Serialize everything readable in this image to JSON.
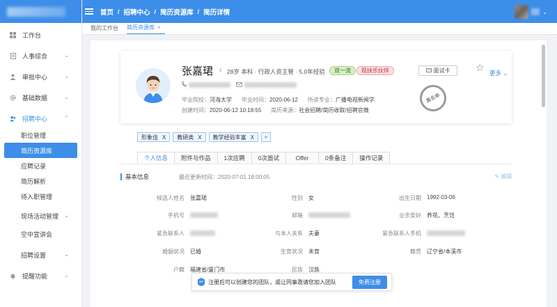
{
  "topbar": {
    "breadcrumbs": [
      "首页",
      "招聘中心",
      "简历资源库",
      "简历详情"
    ],
    "separator": "/"
  },
  "sidebar": {
    "items": [
      {
        "label": "工作台",
        "icon": "grid-icon",
        "has_children": false
      },
      {
        "label": "人事综合",
        "icon": "document-icon",
        "has_children": true
      },
      {
        "label": "审批中心",
        "icon": "person-icon",
        "has_children": true
      },
      {
        "label": "基础数据",
        "icon": "gear-icon",
        "has_children": true
      },
      {
        "label": "招聘中心",
        "icon": "people-icon",
        "has_children": true,
        "expanded": true,
        "children": [
          "职位管理",
          "简历资源库",
          "应聘记录",
          "简历解析",
          "待入职管理"
        ]
      },
      {
        "label": "现场活动管理",
        "icon": "",
        "has_children": true
      },
      {
        "label": "空中宣讲会",
        "icon": "",
        "has_children": false
      },
      {
        "label": "招聘设置",
        "icon": "",
        "has_children": true
      },
      {
        "label": "提醒功能",
        "icon": "bell-icon",
        "has_children": true
      }
    ],
    "active_child": "简历资源库"
  },
  "tabs": {
    "items": [
      "我的工作台",
      "简历资源库"
    ],
    "close_glyph": "×"
  },
  "profile": {
    "name": "张嘉珺",
    "gender_symbol": "♀",
    "brief": "28岁 本科 · 行政人资主管 · 5.0年经验",
    "tags": [
      "双一流",
      "现扶乐伙伴"
    ],
    "school_label": "毕业院校：",
    "school": "河海大学",
    "grad_time_label": "毕业时间：",
    "grad_time": "2020-06-12",
    "major_label": "所读专业：",
    "major": "广播电视新闻学",
    "created_label": "创建时间：",
    "created": "2020-06-12 10:18:55",
    "source_label": "简历来源：",
    "source": "社会招聘/简历收取/招聘官微",
    "resume_button": "面试卡",
    "more": "更多",
    "stamp": "黑名单"
  },
  "skill_tags": [
    "形象佳",
    "教研类",
    "教学经验丰富"
  ],
  "skill_tag_close": "X",
  "skill_add": "+",
  "subtabs": [
    "个人信息",
    "附件与作品",
    "1次应聘",
    "0次面试",
    "Offer",
    "0条备注",
    "操作记录"
  ],
  "active_subtab": "个人信息",
  "basic_info": {
    "title": "基本信息",
    "last_update": "最近更新时间：2020-07-01 18:00:05",
    "edit": "编辑",
    "rows": [
      [
        {
          "label": "候选人姓名",
          "value": "张嘉珺"
        },
        {
          "label": "性别",
          "value": "女"
        },
        {
          "label": "出生日期",
          "value": "1992-03-06"
        }
      ],
      [
        {
          "label": "手机号",
          "value": ""
        },
        {
          "label": "邮箱",
          "value": ""
        },
        {
          "label": "业余爱好",
          "value": "养花、烹饪"
        }
      ],
      [
        {
          "label": "紧急联系人",
          "value": ""
        },
        {
          "label": "与本人关系",
          "value": "夫妻"
        },
        {
          "label": "紧急联系人手机",
          "value": ""
        }
      ],
      [
        {
          "label": "婚姻状况",
          "value": "已婚"
        },
        {
          "label": "生育状况",
          "value": "未育"
        },
        {
          "label": "籍贯",
          "value": "辽宁省/本溪市"
        }
      ],
      [
        {
          "label": "户籍",
          "value": "福建省/厦门市"
        },
        {
          "label": "民族",
          "value": "汉族"
        },
        {
          "label": "",
          "value": ""
        }
      ]
    ]
  },
  "toast": {
    "message": "注册后可以创建您的团队，或让同事邀请您加入团队",
    "button": "免费注册"
  },
  "colors": {
    "primary": "#3d8ee8",
    "tag_green": "#d7efc7",
    "tag_pink": "#fde0e3"
  }
}
